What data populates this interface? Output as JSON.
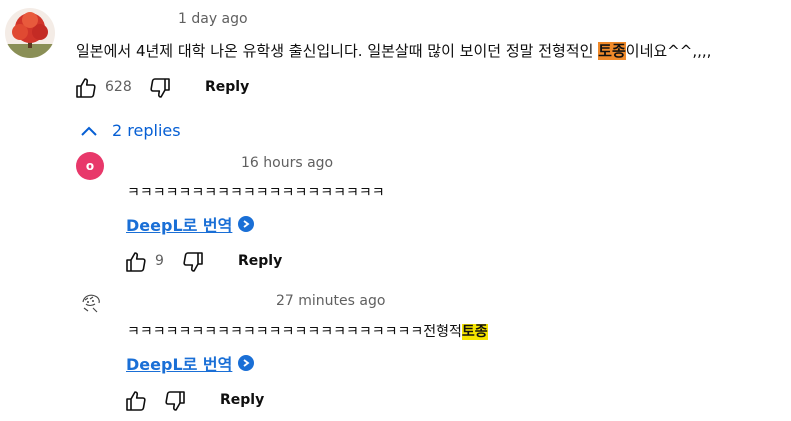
{
  "comment": {
    "time": "1 day ago",
    "text_before": "일본에서 4년제 대학 나온 유학생 출신입니다. 일본살때 많이 보이던 정말 전형적인 ",
    "highlight": "토종",
    "text_after": "이네요^^,,,,",
    "like_count": "628",
    "reply_label": "Reply",
    "highlight_color": "#f08a2a"
  },
  "replies_toggle": {
    "label": "2 replies"
  },
  "replies": [
    {
      "avatar_letter": "o",
      "avatar_color": "#e8386a",
      "time": "16 hours ago",
      "text": "ㅋㅋㅋㅋㅋㅋㅋㅋㅋㅋㅋㅋㅋㅋㅋㅋㅋㅋㅋㅋ",
      "translate_label": "DeepL로 번역",
      "like_count": "9",
      "reply_label": "Reply"
    },
    {
      "time": "27 minutes ago",
      "text_before": "ㅋㅋㅋㅋㅋㅋㅋㅋㅋㅋㅋㅋㅋㅋㅋㅋㅋㅋㅋㅋㅋㅋㅋ전형적",
      "highlight": "토종",
      "translate_label": "DeepL로 번역",
      "reply_label": "Reply",
      "highlight_color": "#f5e400"
    }
  ]
}
